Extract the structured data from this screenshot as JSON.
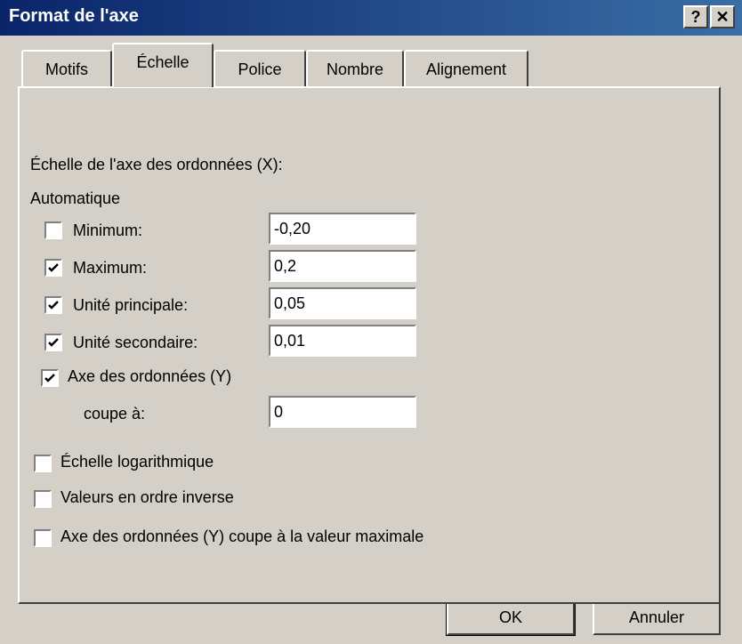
{
  "window": {
    "title": "Format de l'axe",
    "help_label": "?",
    "close_label": "✕"
  },
  "tabs": [
    {
      "label": "Motifs"
    },
    {
      "label": "Échelle",
      "active": true
    },
    {
      "label": "Police"
    },
    {
      "label": "Nombre"
    },
    {
      "label": "Alignement"
    }
  ],
  "scale": {
    "heading": "Échelle de l'axe des ordonnées (X):",
    "auto_label": "Automatique",
    "minimum": {
      "label": "Minimum:",
      "checked": false,
      "value": "-0,20"
    },
    "maximum": {
      "label": "Maximum:",
      "checked": true,
      "value": "0,2"
    },
    "major_unit": {
      "label": "Unité principale:",
      "checked": true,
      "value": "0,05"
    },
    "minor_unit": {
      "label": "Unité secondaire:",
      "checked": true,
      "value": "0,01"
    },
    "crosses": {
      "label": "Axe des ordonnées (Y)",
      "checked": true
    },
    "crosses_at": {
      "label": "coupe à:",
      "value": "0"
    },
    "log_scale": {
      "label": "Échelle logarithmique",
      "checked": false
    },
    "reverse": {
      "label": "Valeurs en ordre inverse",
      "checked": false
    },
    "cross_max": {
      "label": "Axe des ordonnées (Y) coupe à la valeur maximale",
      "checked": false
    }
  },
  "buttons": {
    "ok": "OK",
    "cancel": "Annuler"
  }
}
